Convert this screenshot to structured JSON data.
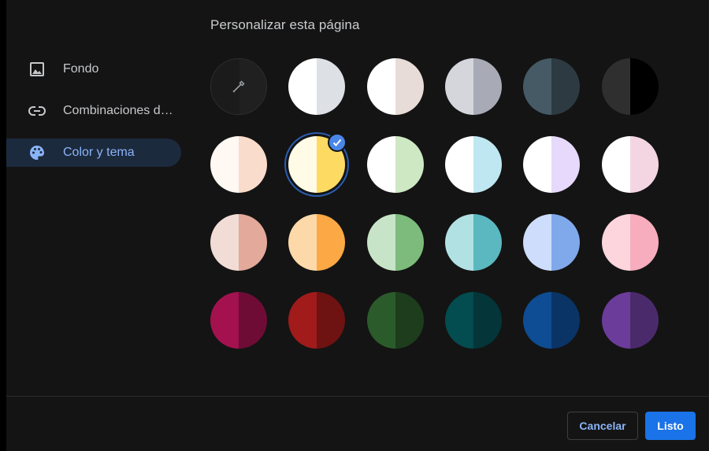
{
  "dialog": {
    "title": "Personalizar esta página"
  },
  "sidebar": {
    "items": [
      {
        "label": "Fondo",
        "icon": "image-icon",
        "active": false
      },
      {
        "label": "Combinaciones de...",
        "icon": "link-icon",
        "active": false
      },
      {
        "label": "Color y tema",
        "icon": "palette-icon",
        "active": true
      }
    ]
  },
  "palette": {
    "picker_icon": "eyedropper-icon",
    "selected_index": 7,
    "swatches": [
      {
        "left": "#1b1b1b",
        "right": "#202020",
        "type": "picker"
      },
      {
        "left": "#ffffff",
        "right": "#dde1e6"
      },
      {
        "left": "#ffffff",
        "right": "#e7dcd8"
      },
      {
        "left": "#d5d6dc",
        "right": "#a8abb6"
      },
      {
        "left": "#455a64",
        "right": "#2d3a41"
      },
      {
        "left": "#2f2f2f",
        "right": "#000000"
      },
      {
        "left": "#fff8f3",
        "right": "#f9dccb"
      },
      {
        "left": "#fffbe6",
        "right": "#fddb63"
      },
      {
        "left": "#ffffff",
        "right": "#cde8c3"
      },
      {
        "left": "#ffffff",
        "right": "#bfe7f1"
      },
      {
        "left": "#ffffff",
        "right": "#e6d9fb"
      },
      {
        "left": "#ffffff",
        "right": "#f4d6e3"
      },
      {
        "left": "#f2ddd6",
        "right": "#e3a99a"
      },
      {
        "left": "#fdd9a9",
        "right": "#fba845"
      },
      {
        "left": "#c8e4c8",
        "right": "#7cbb7b"
      },
      {
        "left": "#b2e1e3",
        "right": "#5bb8c0"
      },
      {
        "left": "#cdddfb",
        "right": "#80a9eb"
      },
      {
        "left": "#fcd5dd",
        "right": "#f7adbd"
      },
      {
        "left": "#a3124f",
        "right": "#6e0c36"
      },
      {
        "left": "#a11b1b",
        "right": "#6e1212"
      },
      {
        "left": "#2b5b2b",
        "right": "#1d3d1d"
      },
      {
        "left": "#034c50",
        "right": "#033539"
      },
      {
        "left": "#0e4c94",
        "right": "#0a3466"
      },
      {
        "left": "#6c3c9a",
        "right": "#4b2a6c"
      }
    ]
  },
  "footer": {
    "cancel_label": "Cancelar",
    "done_label": "Listo"
  },
  "colors": {
    "accent": "#1a73e8",
    "accent_text": "#8ab4f8",
    "background": "#141414"
  }
}
